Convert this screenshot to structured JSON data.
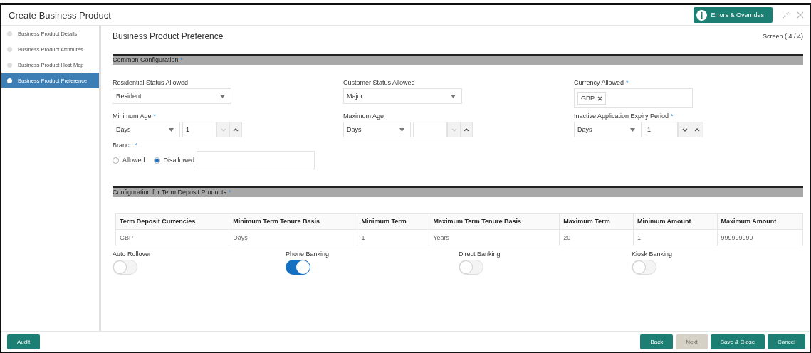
{
  "window": {
    "title": "Create Business Product",
    "errors_button": "Errors & Overrides"
  },
  "steps": [
    {
      "label": "Business Product Details",
      "selected": false
    },
    {
      "label": "Business Product Attributes",
      "selected": false
    },
    {
      "label": "Business Product Host Map",
      "more": "...",
      "selected": false
    },
    {
      "label": "Business Product Preference",
      "selected": true
    }
  ],
  "page": {
    "title": "Business Product Preference",
    "screen": "Screen ( 4 / 4)"
  },
  "common_configuration": {
    "title": "Common Configuration",
    "required_mark": "*",
    "fields": [
      {
        "kind": "select",
        "label": "Residential Status Allowed",
        "value": "Resident"
      },
      {
        "kind": "select",
        "label": "Customer Status Allowed",
        "value": "Major"
      },
      {
        "kind": "chips",
        "label": "Currency Allowed",
        "required_mark": "*",
        "chips": [
          "GBP"
        ]
      },
      {
        "kind": "period",
        "label": "Minimum Age",
        "required_mark": "*",
        "unit": "Days",
        "value": "1",
        "decrement_disabled": true
      },
      {
        "kind": "period",
        "label": "Maximum Age",
        "unit": "Days",
        "decrement_disabled": true
      },
      {
        "kind": "period",
        "label": "Inactive Application Expiry Period",
        "required_mark": "*",
        "unit": "Days",
        "value": "1",
        "decrement_disabled": false
      },
      {
        "kind": "radio",
        "label": "Branch",
        "required_mark": "*",
        "options": [
          {
            "label": "Allowed",
            "selected": false
          },
          {
            "label": "Disallowed",
            "selected": true
          }
        ]
      }
    ]
  },
  "term_deposit": {
    "title": "Configuration for Term Deposit Products",
    "required_mark": "*",
    "table": {
      "columns": [
        "Term Deposit Currencies",
        "Minimum Term Tenure Basis",
        "Minimum Term",
        "Maximum Term Tenure Basis",
        "Maximum Term",
        "Minimum Amount",
        "Maximum Amount"
      ],
      "rows": [
        [
          "GBP",
          "Days",
          "1",
          "Years",
          "20",
          "1",
          "999999999"
        ]
      ]
    },
    "toggles": [
      {
        "label": "Auto Rollover",
        "on": false
      },
      {
        "label": "Phone Banking",
        "on": true
      },
      {
        "label": "Direct Banking",
        "on": false
      },
      {
        "label": "Kiosk Banking",
        "on": false
      }
    ]
  },
  "footer": {
    "left": [
      {
        "label": "Audit",
        "disabled": false
      }
    ],
    "right": [
      {
        "label": "Back",
        "disabled": false
      },
      {
        "label": "Next",
        "disabled": true
      },
      {
        "label": "Save & Close",
        "disabled": false
      },
      {
        "label": "Cancel",
        "disabled": false
      }
    ]
  }
}
